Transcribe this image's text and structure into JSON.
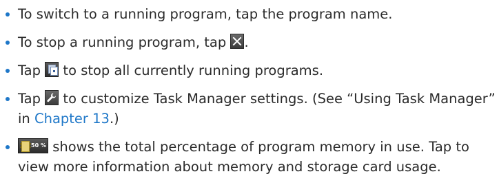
{
  "colors": {
    "bullet": "#1e77c8",
    "link": "#1e77c8",
    "text": "#2b2b2b"
  },
  "items": [
    {
      "text": "To switch to a running program, tap the program name."
    },
    {
      "text": "To stop a running program, tap",
      "icon": "close-x-icon",
      "after": "."
    },
    {
      "before": "Tap",
      "icon": "stop-all-programs-icon",
      "text": "to stop all currently running programs."
    },
    {
      "before": "Tap",
      "icon": "settings-wrench-icon",
      "text": "to customize Task Manager settings. (See “Using Task Manager” in",
      "link": "Chapter 13",
      "after": ".)"
    },
    {
      "icon": "memory-usage-icon",
      "icon_label": "50 %",
      "text": "shows the total percentage of program memory in use. Tap to view more information about memory and storage card usage."
    }
  ]
}
